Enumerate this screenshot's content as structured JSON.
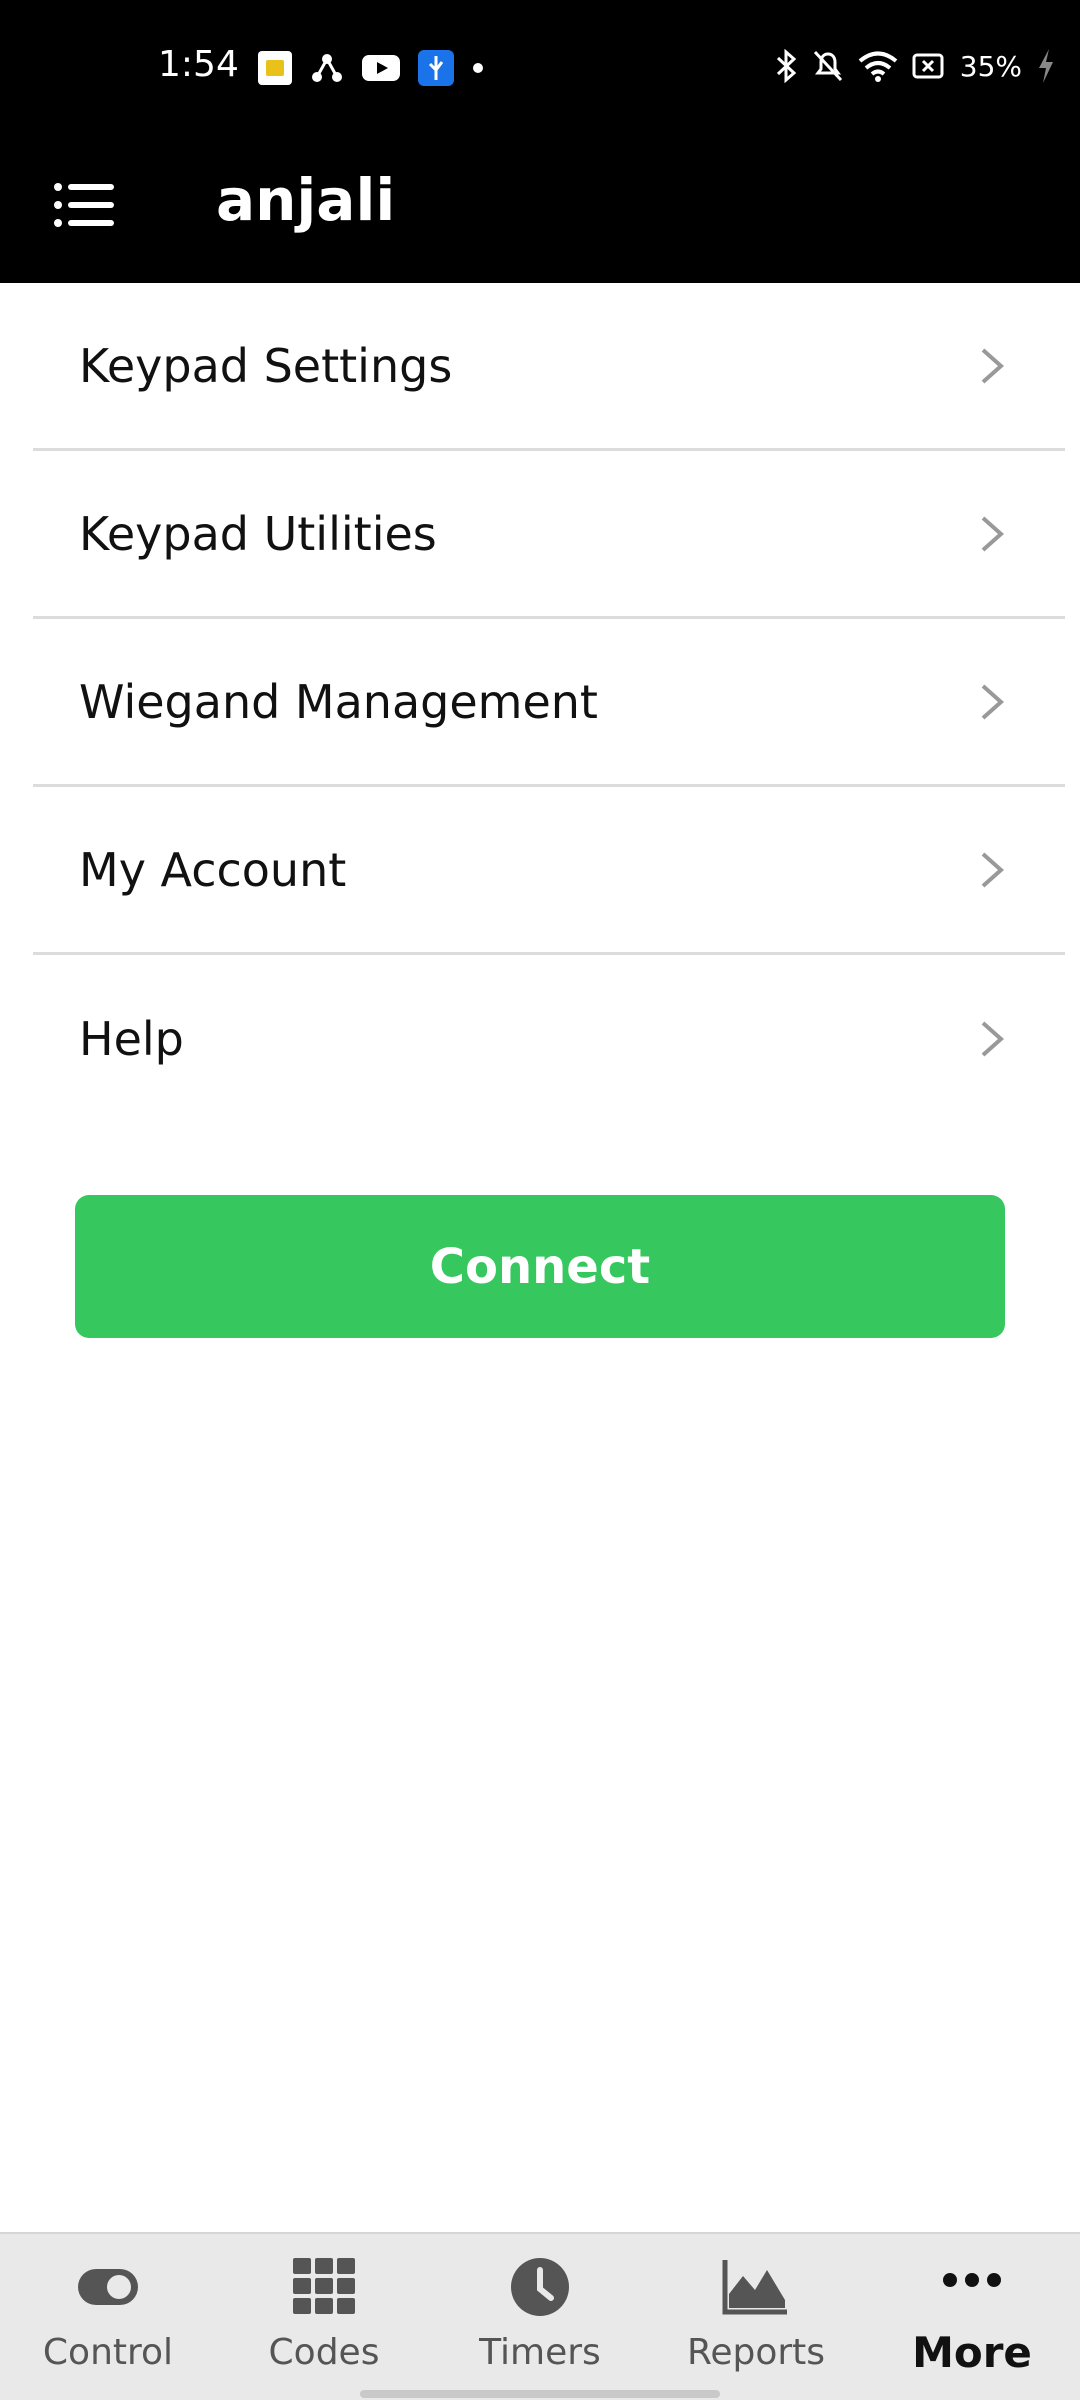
{
  "status_bar": {
    "time": "1:54",
    "battery": "35%",
    "icons": [
      "sim-notification-icon",
      "share-icon",
      "youtube-icon",
      "usb-icon",
      "dot-icon",
      "bluetooth-icon",
      "bell-off-icon",
      "wifi-icon",
      "battery-saver-icon",
      "charging-icon"
    ]
  },
  "header": {
    "title": "anjali",
    "menu_icon": "list-menu-icon"
  },
  "menu": {
    "items": [
      {
        "label": "Keypad Settings"
      },
      {
        "label": "Keypad Utilities"
      },
      {
        "label": "Wiegand Management"
      },
      {
        "label": "My Account"
      },
      {
        "label": "Help"
      }
    ]
  },
  "connect_button": {
    "label": "Connect",
    "color": "#36c75e"
  },
  "bottom_nav": {
    "items": [
      {
        "label": "Control",
        "icon": "toggle-icon"
      },
      {
        "label": "Codes",
        "icon": "grid-icon"
      },
      {
        "label": "Timers",
        "icon": "clock-icon"
      },
      {
        "label": "Reports",
        "icon": "area-chart-icon"
      },
      {
        "label": "More",
        "icon": "more-dots-icon",
        "active": true
      }
    ]
  }
}
